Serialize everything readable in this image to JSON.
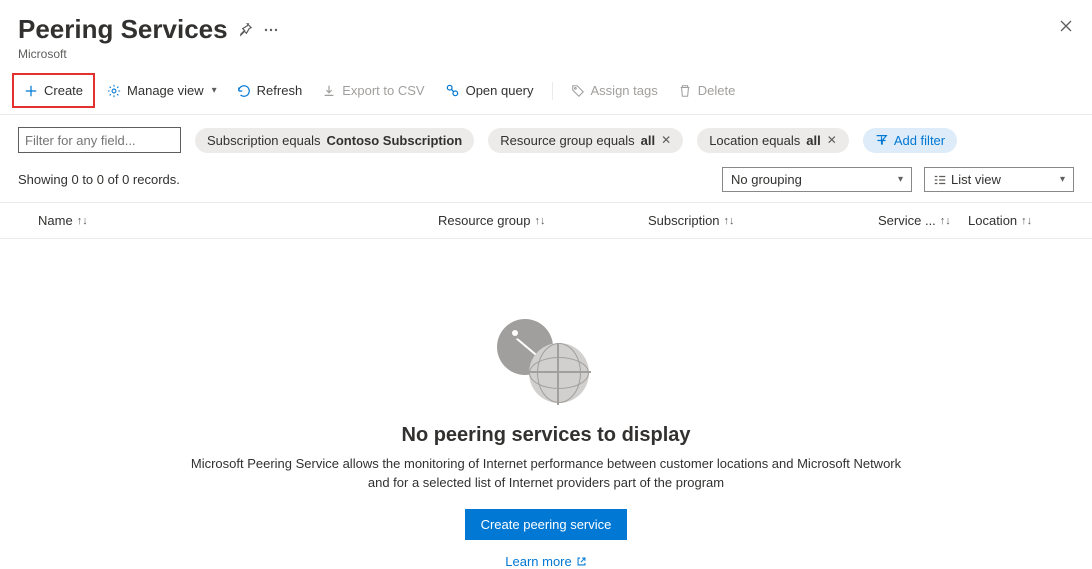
{
  "header": {
    "title": "Peering Services",
    "subtitle": "Microsoft"
  },
  "toolbar": {
    "create": "Create",
    "manage_view": "Manage view",
    "refresh": "Refresh",
    "export_csv": "Export to CSV",
    "open_query": "Open query",
    "assign_tags": "Assign tags",
    "delete": "Delete"
  },
  "filters": {
    "input_placeholder": "Filter for any field...",
    "subscription_prefix": "Subscription equals ",
    "subscription_value": "Contoso Subscription",
    "resource_group_prefix": "Resource group equals ",
    "resource_group_value": "all",
    "location_prefix": "Location equals ",
    "location_value": "all",
    "add_filter": "Add filter"
  },
  "status": {
    "records": "Showing 0 to 0 of 0 records.",
    "grouping": "No grouping",
    "view_mode": "List view"
  },
  "columns": {
    "name": "Name",
    "resource_group": "Resource group",
    "subscription": "Subscription",
    "service": "Service ...",
    "location": "Location"
  },
  "empty": {
    "title": "No peering services to display",
    "description": "Microsoft Peering Service allows the monitoring of Internet performance between customer locations and Microsoft Network and for a selected list of Internet providers part of the program",
    "button": "Create peering service",
    "learn_more": "Learn more"
  }
}
